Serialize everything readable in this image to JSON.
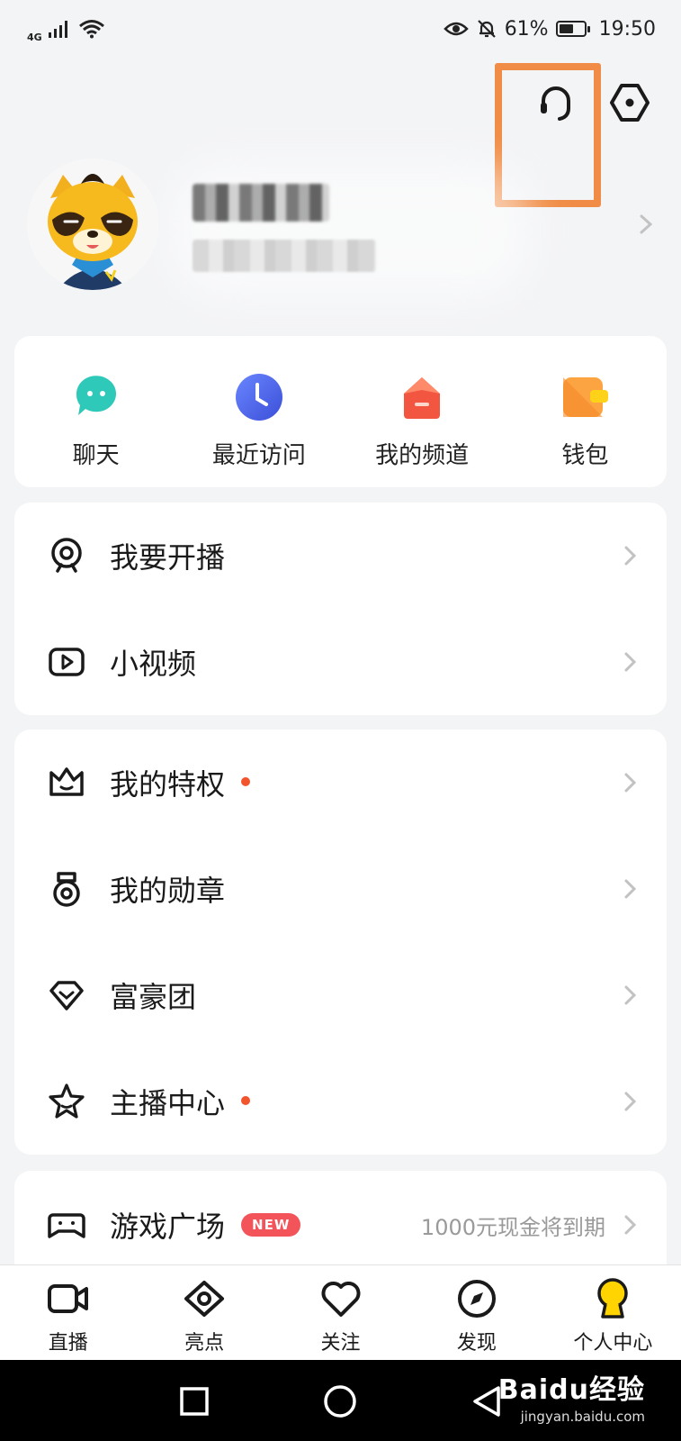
{
  "status_bar": {
    "network": "4G",
    "battery": "61%",
    "battery_level": 0.61,
    "time": "19:50"
  },
  "header": {
    "support_icon": "headset-icon",
    "settings_icon": "hexagon-settings-icon",
    "highlight_color": "#f08c45"
  },
  "profile": {
    "avatar_icon": "raccoon-mascot-avatar"
  },
  "quick_actions": [
    {
      "label": "聊天",
      "icon": "chat-bubble-icon",
      "color": "#2ec9b8"
    },
    {
      "label": "最近访问",
      "icon": "clock-icon",
      "color": "#4f6cf0"
    },
    {
      "label": "我的频道",
      "icon": "house-icon",
      "color": "#f25640"
    },
    {
      "label": "钱包",
      "icon": "wallet-icon",
      "color": "#fba441"
    }
  ],
  "menu_group_1": [
    {
      "label": "我要开播",
      "icon": "webcam-icon"
    },
    {
      "label": "小视频",
      "icon": "video-play-icon"
    }
  ],
  "menu_group_2": [
    {
      "label": "我的特权",
      "icon": "crown-icon",
      "dot": true
    },
    {
      "label": "我的勋章",
      "icon": "medal-icon",
      "dot": false
    },
    {
      "label": "富豪团",
      "icon": "diamond-icon",
      "dot": false
    },
    {
      "label": "主播中心",
      "icon": "star-icon",
      "dot": true
    }
  ],
  "menu_group_3": [
    {
      "label": "游戏广场",
      "icon": "gamepad-icon",
      "badge": "NEW",
      "note": "1000元现金将到期"
    }
  ],
  "tabs": [
    {
      "label": "直播",
      "icon": "video-camera-icon"
    },
    {
      "label": "亮点",
      "icon": "eye-icon"
    },
    {
      "label": "关注",
      "icon": "heart-icon"
    },
    {
      "label": "发现",
      "icon": "compass-icon"
    },
    {
      "label": "个人中心",
      "icon": "keyhole-person-icon",
      "active": true,
      "active_color": "#ffd400"
    }
  ],
  "watermark": {
    "brand": "Baidu经验",
    "url": "jingyan.baidu.com"
  }
}
